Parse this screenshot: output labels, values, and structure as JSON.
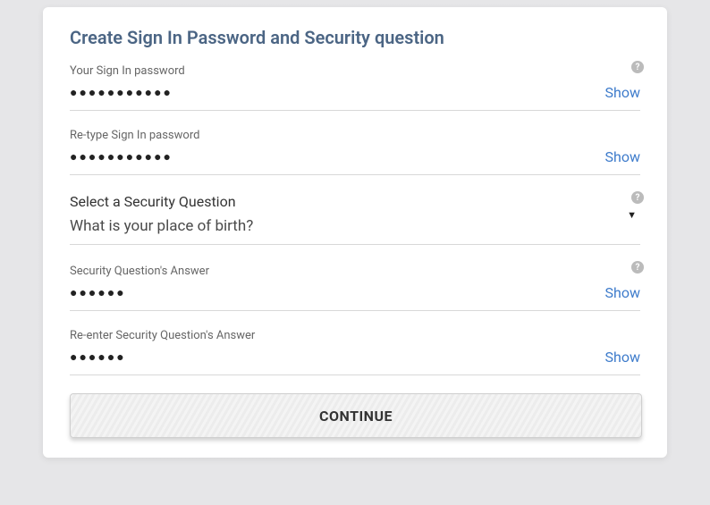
{
  "title": "Create Sign In Password and Security question",
  "password": {
    "label": "Your Sign In password",
    "masked": "●●●●●●●●●●●",
    "showLabel": "Show"
  },
  "passwordRetype": {
    "label": "Re-type Sign In password",
    "masked": "●●●●●●●●●●●",
    "showLabel": "Show"
  },
  "securityQuestion": {
    "heading": "Select a Security Question",
    "selected": "What is your place of birth?"
  },
  "securityAnswer": {
    "label": "Security Question's Answer",
    "masked": "●●●●●●",
    "showLabel": "Show"
  },
  "securityAnswerRetype": {
    "label": "Re-enter Security Question's Answer",
    "masked": "●●●●●●",
    "showLabel": "Show"
  },
  "continueLabel": "CONTINUE",
  "helpGlyph": "?"
}
